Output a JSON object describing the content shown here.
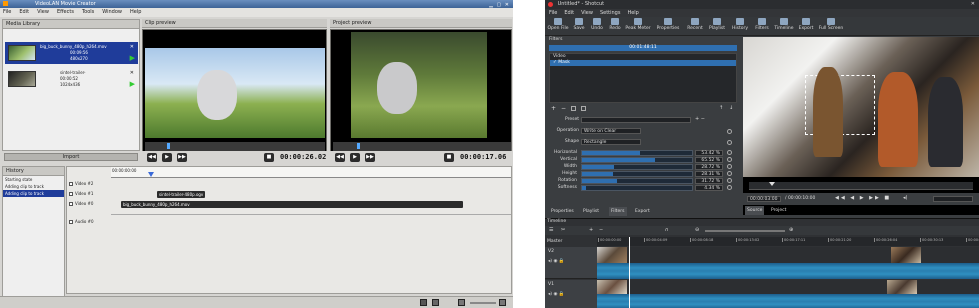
{
  "vlmc": {
    "title": "VideoLAN Movie Creator",
    "menu": [
      "File",
      "Edit",
      "View",
      "Effects",
      "Tools",
      "Window",
      "Help"
    ],
    "media_library_title": "Media Library",
    "media_items": [
      {
        "name": "big_buck_bunny_480p_h264.mov",
        "duration": "00:09:56",
        "info": "480x270"
      },
      {
        "name": "sintel-trailer-",
        "duration": "00:00:52",
        "info": "1024x436"
      }
    ],
    "import_label": "Import",
    "history_title": "History",
    "history_items": [
      "Starting state",
      "Adding clip to track",
      "Adding clip to track"
    ],
    "clip_preview_title": "Clip preview",
    "project_preview_title": "Project preview",
    "clip_timecode": "00:00:26.02",
    "project_timecode": "00:00:17.06",
    "ruler_label": "00:00:00:00",
    "tracks": [
      {
        "label": "Video #2"
      },
      {
        "label": "Video #1"
      },
      {
        "label": "Video #0"
      },
      {
        "label": "Audio #0"
      }
    ],
    "clips": [
      {
        "label": "sintel-trailer-480p.ogv"
      },
      {
        "label": "big_buck_bunny_480p_h264.mov"
      }
    ]
  },
  "shotcut": {
    "title": "Untitled* - Shotcut",
    "menu": [
      "File",
      "Edit",
      "View",
      "Settings",
      "Help"
    ],
    "toolbar": [
      "Open File",
      "Save",
      "Undo",
      "Redo",
      "Peak Meter",
      "Properties",
      "Recent",
      "Playlist",
      "History",
      "Filters",
      "Timeline",
      "Export",
      "Full Screen"
    ],
    "filters_title": "Filters",
    "filter_timecode": "00:01:48:11",
    "filter_list": [
      "Video",
      "Mask"
    ],
    "preset_label": "Preset",
    "operation_label": "Operation",
    "operation_value": "Write on Clear",
    "shape_label": "Shape",
    "shape_value": "Rectangle",
    "sliders": [
      {
        "label": "Horizontal",
        "value": "53.42 %",
        "fill": 0.53
      },
      {
        "label": "Vertical",
        "value": "65.52 %",
        "fill": 0.66
      },
      {
        "label": "Width",
        "value": "28.72 %",
        "fill": 0.29
      },
      {
        "label": "Height",
        "value": "28.31 %",
        "fill": 0.28
      },
      {
        "label": "Rotation",
        "value": "31.72 %",
        "fill": 0.32
      },
      {
        "label": "Softness",
        "value": "4.34 %",
        "fill": 0.04
      }
    ],
    "panel_tabs": [
      "Properties",
      "Playlist",
      "Filters",
      "Export"
    ],
    "viewer_timecode": "00:00:03:00",
    "viewer_duration": "/ 00:00:10:00",
    "source_tabs": [
      "Source",
      "Project"
    ],
    "timeline_title": "Timeline",
    "master_label": "Master",
    "timeline_ticks": [
      "00:00:00:00",
      "00:00:04:09",
      "00:00:08:18",
      "00:00:13:02",
      "00:00:17:11",
      "00:00:21:20",
      "00:00:26:04",
      "00:00:30:13",
      "00:00:34:22"
    ],
    "tracks": [
      "V2",
      "V1"
    ]
  }
}
